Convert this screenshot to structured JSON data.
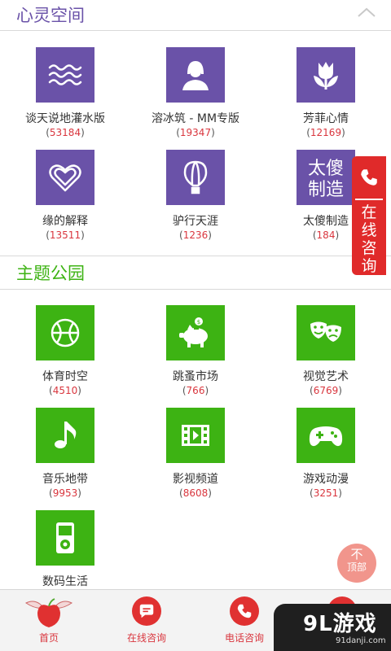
{
  "sections": [
    {
      "title": "心灵空间",
      "title_color": "#6a52a8",
      "tile_color": "#6a52a8",
      "items": [
        {
          "label": "谈天说地灌水版",
          "count": "53184",
          "icon": "waves-icon"
        },
        {
          "label": "溶冰筑 - MM专版",
          "count": "19347",
          "icon": "woman-avatar-icon"
        },
        {
          "label": "芳菲心情",
          "count": "12169",
          "icon": "tulip-icon"
        },
        {
          "label": "缘的解释",
          "count": "13511",
          "icon": "heart-icon"
        },
        {
          "label": "驴行天涯",
          "count": "1236",
          "icon": "hot-air-balloon-icon"
        },
        {
          "label": "太傻制造",
          "count": "184",
          "icon": "text-logo-icon",
          "tile_text": "太傻\n制造"
        }
      ]
    },
    {
      "title": "主题公园",
      "title_color": "#3db313",
      "tile_color": "#3db313",
      "items": [
        {
          "label": "体育时空",
          "count": "4510",
          "icon": "basketball-icon"
        },
        {
          "label": "跳蚤市场",
          "count": "766",
          "icon": "piggy-bank-icon"
        },
        {
          "label": "视觉艺术",
          "count": "6769",
          "icon": "drama-masks-icon"
        },
        {
          "label": "音乐地带",
          "count": "9953",
          "icon": "music-note-icon"
        },
        {
          "label": "影视频道",
          "count": "8608",
          "icon": "film-icon"
        },
        {
          "label": "游戏动漫",
          "count": "3251",
          "icon": "gamepad-icon"
        },
        {
          "label": "数码生活",
          "count": "",
          "icon": "music-player-icon"
        }
      ]
    }
  ],
  "side_tab": {
    "text": "在线咨询",
    "icon": "phone-icon",
    "color": "#e02a2a"
  },
  "top_button": {
    "arrow": "不",
    "text": "顶部"
  },
  "bottom_nav": [
    {
      "label": "首页",
      "icon": "apple-wings-icon"
    },
    {
      "label": "在线咨询",
      "icon": "chat-bubble-icon"
    },
    {
      "label": "电话咨询",
      "icon": "phone-call-icon"
    },
    {
      "label": "",
      "icon": "partial-icon"
    }
  ],
  "watermark": {
    "logo": "9L游戏",
    "url": "91danji.com"
  }
}
